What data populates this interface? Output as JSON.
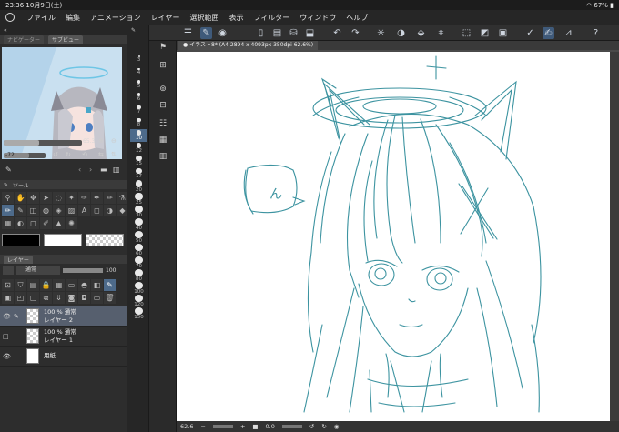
{
  "status": {
    "time": "23:36",
    "date": "10月9日(土)",
    "battery": "67%"
  },
  "menu": [
    "ファイル",
    "編集",
    "アニメーション",
    "レイヤー",
    "選択範囲",
    "表示",
    "フィルター",
    "ウィンドウ",
    "ヘルプ"
  ],
  "navigator": {
    "tab_nav": "ナビゲーター",
    "tab_sub": "サブビュー",
    "zoom": "65.3",
    "angle": "-72"
  },
  "tools_panel": {
    "title": "ツール"
  },
  "brush_sizes": [
    "3",
    "4",
    "5",
    "6",
    "7",
    "8",
    "10",
    "12",
    "15",
    "17",
    "20",
    "25",
    "30",
    "40",
    "50",
    "60",
    "70",
    "80",
    "100",
    "120",
    "150"
  ],
  "layer_panel": {
    "tab_layer": "レイヤー",
    "blend_mode": "通常",
    "opacity": "100"
  },
  "layers": [
    {
      "line1": "100 % 通常",
      "line2": "レイヤー 2",
      "selected": true
    },
    {
      "line1": "100 % 通常",
      "line2": "レイヤー 1",
      "selected": false
    },
    {
      "line1": "",
      "line2": "用紙",
      "selected": false
    }
  ],
  "document": {
    "tab_title": "● イラスト8* (A4 2894 x 4093px 350dpi 62.6%)"
  },
  "bottom": {
    "zoom": "62.6",
    "angle": "0.0"
  },
  "speech_text": "ん",
  "colors": {
    "line": "#3c93a0",
    "main": "#000000",
    "sub": "#ffffff"
  }
}
